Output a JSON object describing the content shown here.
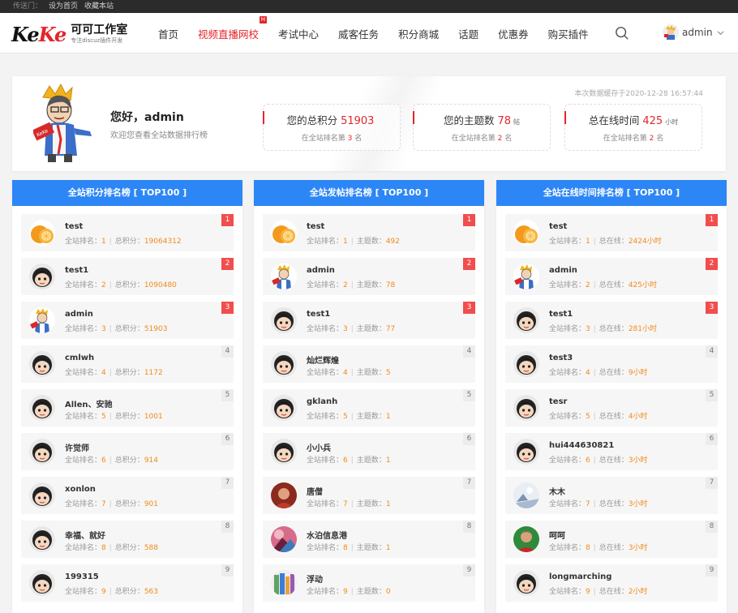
{
  "topbar": {
    "prefix": "传送门：",
    "links": [
      "设为首页",
      "收藏本站"
    ]
  },
  "logo": {
    "mark_black": "Ke",
    "mark_red": "Ke",
    "name": "可可工作室",
    "tagline": "专注discuz插件开发"
  },
  "nav": {
    "items": [
      "首页",
      "视频直播网校",
      "考试中心",
      "威客任务",
      "积分商城",
      "话题",
      "优惠券",
      "购买插件"
    ],
    "hot_badge": "H",
    "username": "admin"
  },
  "profile": {
    "greeting": "您好，admin",
    "welcome": "欢迎您查看全站数据排行榜",
    "cache_note": "本次数据缓存于2020-12-28 16:57:44",
    "stats": [
      {
        "label": "您的总积分",
        "value": "51903",
        "unit": "",
        "rank_prefix": "在全站排名第",
        "rank": "3",
        "rank_suffix": "名"
      },
      {
        "label": "您的主题数",
        "value": "78",
        "unit": "帖",
        "rank_prefix": "在全站排名第",
        "rank": "2",
        "rank_suffix": "名"
      },
      {
        "label": "总在线时间",
        "value": "425",
        "unit": "小时",
        "rank_prefix": "在全站排名第",
        "rank": "2",
        "rank_suffix": "名"
      }
    ]
  },
  "columns": [
    {
      "title": "全站积分排名榜 [ TOP100 ]",
      "metric_label": "总积分",
      "items": [
        {
          "rank": "1",
          "name": "test",
          "avatar": "orange",
          "value": "19064312"
        },
        {
          "rank": "2",
          "name": "test1",
          "avatar": "default",
          "value": "1090480"
        },
        {
          "rank": "3",
          "name": "admin",
          "avatar": "cartoon",
          "value": "51903"
        },
        {
          "rank": "4",
          "name": "cmlwh",
          "avatar": "default",
          "value": "1172"
        },
        {
          "rank": "5",
          "name": "Allen、安驰",
          "avatar": "default",
          "value": "1001"
        },
        {
          "rank": "6",
          "name": "许觉师",
          "avatar": "default",
          "value": "914"
        },
        {
          "rank": "7",
          "name": "xonlon",
          "avatar": "default",
          "value": "901"
        },
        {
          "rank": "8",
          "name": "幸福、就好",
          "avatar": "default",
          "value": "588"
        },
        {
          "rank": "9",
          "name": "199315",
          "avatar": "default",
          "value": "563"
        }
      ]
    },
    {
      "title": "全站发帖排名榜 [ TOP100 ]",
      "metric_label": "主题数",
      "items": [
        {
          "rank": "1",
          "name": "test",
          "avatar": "orange",
          "value": "492"
        },
        {
          "rank": "2",
          "name": "admin",
          "avatar": "cartoon",
          "value": "78"
        },
        {
          "rank": "3",
          "name": "test1",
          "avatar": "default",
          "value": "77"
        },
        {
          "rank": "4",
          "name": "灿烂辉煌",
          "avatar": "default",
          "value": "5"
        },
        {
          "rank": "5",
          "name": "gklanh",
          "avatar": "default",
          "value": "1"
        },
        {
          "rank": "6",
          "name": "小小兵",
          "avatar": "default",
          "value": "1"
        },
        {
          "rank": "7",
          "name": "唐僧",
          "avatar": "photo-red",
          "value": "1"
        },
        {
          "rank": "8",
          "name": "水泊信息港",
          "avatar": "photo-pink",
          "value": "1"
        },
        {
          "rank": "9",
          "name": "浮动",
          "avatar": "photo-books",
          "value": "0"
        }
      ]
    },
    {
      "title": "全站在线时间排名榜 [ TOP100 ]",
      "metric_label": "总在线",
      "items": [
        {
          "rank": "1",
          "name": "test",
          "avatar": "orange",
          "value": "2424小时"
        },
        {
          "rank": "2",
          "name": "admin",
          "avatar": "cartoon",
          "value": "425小时"
        },
        {
          "rank": "3",
          "name": "test1",
          "avatar": "default",
          "value": "281小时"
        },
        {
          "rank": "4",
          "name": "test3",
          "avatar": "default",
          "value": "9小时"
        },
        {
          "rank": "5",
          "name": "tesr",
          "avatar": "default",
          "value": "4小时"
        },
        {
          "rank": "6",
          "name": "hui444630821",
          "avatar": "default",
          "value": "3小时"
        },
        {
          "rank": "7",
          "name": "木木",
          "avatar": "photo-blue",
          "value": "3小时"
        },
        {
          "rank": "8",
          "name": "呵呵",
          "avatar": "photo-man",
          "value": "3小时"
        },
        {
          "rank": "9",
          "name": "longmarching",
          "avatar": "default",
          "value": "2小时"
        }
      ]
    }
  ],
  "rank_label": "全站排名：",
  "colors": {
    "accent": "#e3262b",
    "blue": "#2c86f5",
    "orange": "#f08a1c"
  }
}
